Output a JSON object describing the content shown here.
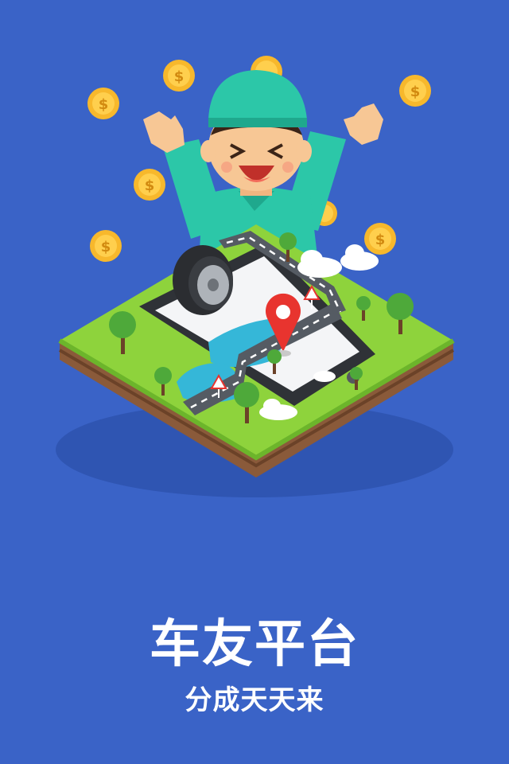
{
  "splash": {
    "title": "车友平台",
    "subtitle": "分成天天来"
  },
  "colors": {
    "background": "#3a63c7",
    "grass": "#8ed33c",
    "soil": "#8a5a3a",
    "coin": "#f7b82c",
    "shirt": "#2cc7a8",
    "road": "#555b63",
    "pin": "#e8342f",
    "water": "#35b7d8"
  },
  "icons": [
    "coin-icon",
    "tire-icon",
    "location-pin-icon",
    "warning-sign-icon",
    "tree-icon",
    "cloud-icon",
    "smartphone-icon"
  ]
}
